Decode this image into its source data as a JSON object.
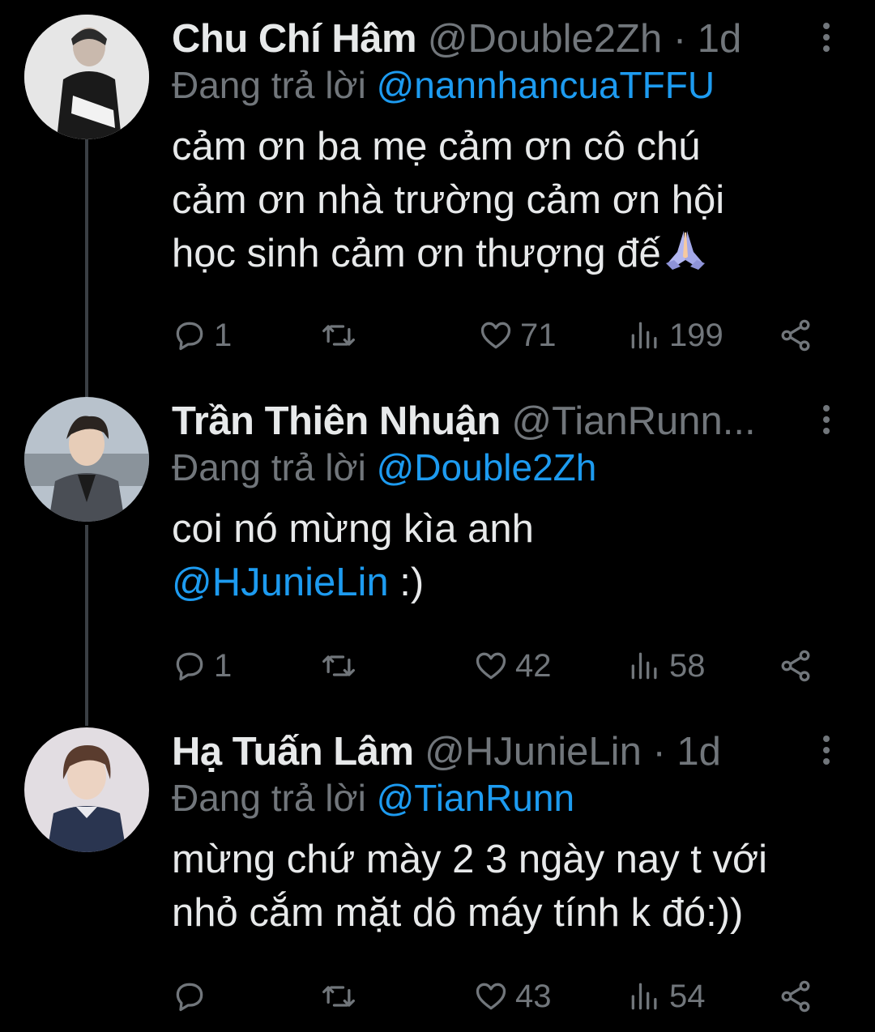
{
  "tweets": [
    {
      "name": "Chu Chí Hâm",
      "handle": "@Double2Zh",
      "time": "· 1d",
      "replying_prefix": "Đang trả lời",
      "replying_to": "@nannhancuaTFFU",
      "body_lines": [
        "cảm ơn ba mẹ cảm ơn cô chú",
        "cảm ơn nhà trường cảm ơn hội",
        "học sinh cảm ơn thượng đế"
      ],
      "replies": "1",
      "retweets": "",
      "likes": "71",
      "views": "199"
    },
    {
      "name": "Trần Thiên Nhuận",
      "handle": "@TianRunn...",
      "time": "",
      "replying_prefix": "Đang trả lời",
      "replying_to": "@Double2Zh",
      "body_line1": "coi nó mừng kìa anh",
      "body_mention": "@HJunieLin",
      "body_mention_suffix": " :)",
      "replies": "1",
      "retweets": "",
      "likes": "42",
      "views": "58"
    },
    {
      "name": "Hạ Tuấn Lâm",
      "handle": "@HJunieLin",
      "time": "· 1d",
      "replying_prefix": "Đang trả lời",
      "replying_to": "@TianRunn",
      "body_lines": [
        "mừng chứ mày 2 3 ngày nay t với",
        "nhỏ cắm mặt dô máy tính k đó:))"
      ],
      "replies": "",
      "retweets": "",
      "likes": "43",
      "views": "54"
    }
  ],
  "colors": {
    "background": "#000000",
    "text": "#e7e9ea",
    "secondary": "#71767b",
    "accent": "#1d9bf0",
    "thread_line": "#3a3f44"
  }
}
